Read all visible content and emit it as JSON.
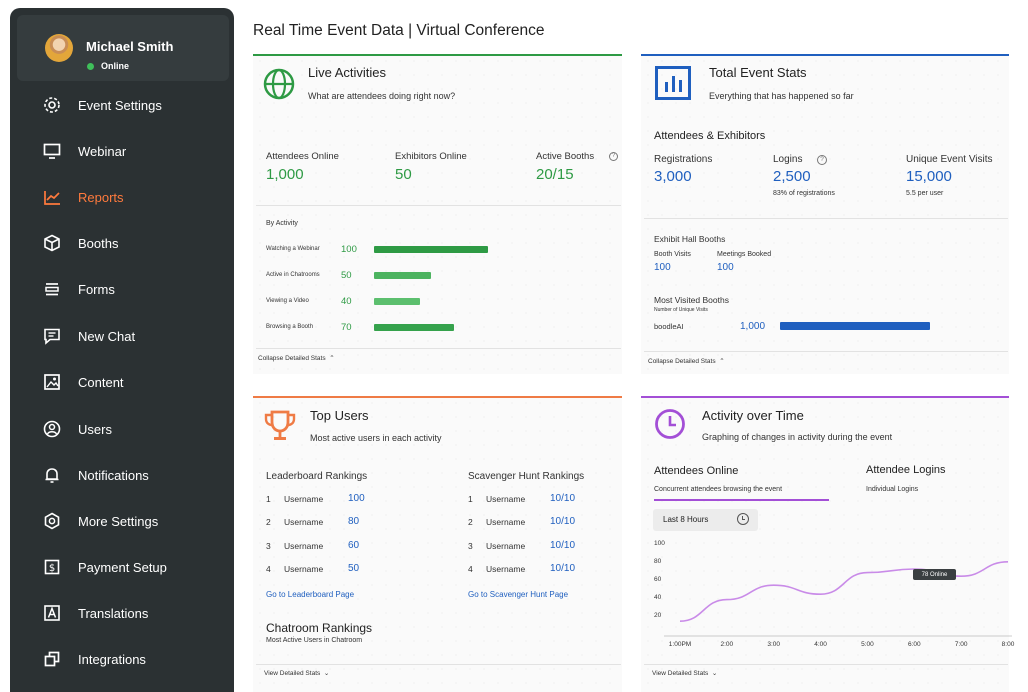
{
  "user": {
    "name": "Michael Smith",
    "status": "Online"
  },
  "nav": [
    {
      "label": "Event Settings",
      "icon": "gear-icon"
    },
    {
      "label": "Webinar",
      "icon": "monitor-icon"
    },
    {
      "label": "Reports",
      "icon": "chart-trend-icon",
      "active": true
    },
    {
      "label": "Booths",
      "icon": "cube-icon"
    },
    {
      "label": "Forms",
      "icon": "form-lines-icon"
    },
    {
      "label": "New Chat",
      "icon": "chat-icon"
    },
    {
      "label": "Content",
      "icon": "image-icon"
    },
    {
      "label": "Users",
      "icon": "user-circle-icon"
    },
    {
      "label": "Notifications",
      "icon": "bell-icon"
    },
    {
      "label": "More Settings",
      "icon": "hex-settings-icon"
    },
    {
      "label": "Payment Setup",
      "icon": "dollar-icon"
    },
    {
      "label": "Translations",
      "icon": "translate-icon"
    },
    {
      "label": "Integrations",
      "icon": "integrations-icon"
    }
  ],
  "page_title": "Real Time Event Data | Virtual Conference",
  "live": {
    "title": "Live Activities",
    "subtitle": "What are attendees doing right now?",
    "stats": [
      {
        "label": "Attendees Online",
        "value": "1,000"
      },
      {
        "label": "Exhibitors Online",
        "value": "50"
      },
      {
        "label": "Active Booths",
        "value": "20/15"
      }
    ],
    "by_activity_label": "By Activity",
    "activities": [
      {
        "label": "Watching a Webinar",
        "value": 100
      },
      {
        "label": "Active in Chatrooms",
        "value": 50
      },
      {
        "label": "Viewing a Video",
        "value": 40
      },
      {
        "label": "Browsing a Booth",
        "value": 70
      }
    ],
    "collapse_label": "Collapse Detailed Stats"
  },
  "total": {
    "title": "Total Event Stats",
    "subtitle": "Everything that has happened so far",
    "section": "Attendees & Exhibitors",
    "registrations_label": "Registrations",
    "registrations": "3,000",
    "logins_label": "Logins",
    "logins": "2,500",
    "logins_note": "83% of registrations",
    "visits_label": "Unique Event Visits",
    "visits": "15,000",
    "visits_note": "5.5 per user",
    "booths_section": "Exhibit Hall Booths",
    "booth_visits_label": "Booth Visits",
    "booth_visits": "100",
    "meetings_label": "Meetings Booked",
    "meetings": "100",
    "most_visited": "Most Visited Booths",
    "most_visited_sub": "Number of Unique Visits",
    "top_booth_name": "boodleAI",
    "top_booth_value": "1,000",
    "top_booth_fraction": 1.0,
    "collapse_label": "Collapse Detailed Stats"
  },
  "top_users": {
    "title": "Top Users",
    "subtitle": "Most active users in each activity",
    "leaderboard_title": "Leaderboard Rankings",
    "leaderboard": [
      {
        "rank": "1",
        "user": "Username",
        "value": "100"
      },
      {
        "rank": "2",
        "user": "Username",
        "value": "80"
      },
      {
        "rank": "3",
        "user": "Username",
        "value": "60"
      },
      {
        "rank": "4",
        "user": "Username",
        "value": "50"
      }
    ],
    "leaderboard_link": "Go to Leaderboard Page",
    "scavenger_title": "Scavenger Hunt Rankings",
    "scavenger": [
      {
        "rank": "1",
        "user": "Username",
        "value": "10/10"
      },
      {
        "rank": "2",
        "user": "Username",
        "value": "10/10"
      },
      {
        "rank": "3",
        "user": "Username",
        "value": "10/10"
      },
      {
        "rank": "4",
        "user": "Username",
        "value": "10/10"
      }
    ],
    "scavenger_link": "Go to Scavenger Hunt Page",
    "chatroom_title": "Chatroom Rankings",
    "chatroom_sub": "Most Active Users in Chatroom",
    "view_label": "View Detailed Stats"
  },
  "activity": {
    "title": "Activity over Time",
    "subtitle": "Graphing of changes in activity during the event",
    "tab1": "Attendees Online",
    "tab1_sub": "Concurrent attendees browsing the event",
    "tab2": "Attendee Logins",
    "tab2_sub": "Individual Logins",
    "range_label": "Last 8 Hours",
    "tooltip": "78 Online",
    "view_label": "View Detailed Stats"
  },
  "colors": {
    "green": "#2e9a44",
    "blue": "#1f5fbf",
    "orange": "#ef7b45",
    "purple": "#a34fd6",
    "sidebar": "#2b3133"
  },
  "chart_data": {
    "type": "line",
    "x": [
      "1:00PM",
      "2:00",
      "3:00",
      "4:00",
      "5:00",
      "6:00",
      "7:00",
      "8:00"
    ],
    "y_ticks": [
      20,
      40,
      60,
      80,
      100
    ],
    "ylim": [
      0,
      100
    ],
    "series": [
      {
        "values": [
          12,
          36,
          52,
          42,
          66,
          70,
          62,
          78
        ]
      }
    ]
  }
}
